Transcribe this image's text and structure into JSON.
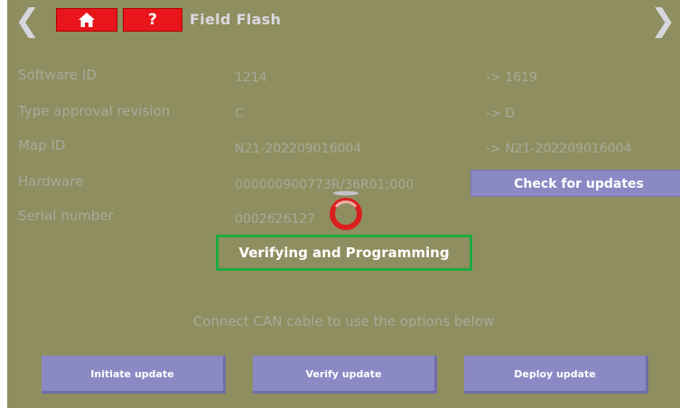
{
  "header": {
    "back_icon": "chevron-left-icon",
    "home_icon": "home-icon",
    "help_label": "?",
    "title": "Field Flash",
    "forward_icon": "chevron-right-icon",
    "accent_color": "#e8161b"
  },
  "info": {
    "rows": [
      {
        "label": "Software ID",
        "current": "1214",
        "target": "-> 1619"
      },
      {
        "label": "Type approval revision",
        "current": "C",
        "target": "-> D"
      },
      {
        "label": "Map ID",
        "current": "N21-202209016004",
        "target": "-> N21-202209016004"
      },
      {
        "label": "Hardware",
        "current": "000000900773R/36R01;000"
      },
      {
        "label": "Serial number",
        "current": "0002626127"
      }
    ],
    "check_button": "Check for updates"
  },
  "status": {
    "spinner_icon": "loading-spinner-icon",
    "message": "Verifying and Programming",
    "highlight_color": "#1cab3f"
  },
  "actions": {
    "instruction": "Connect CAN cable to use the options below",
    "initiate": "Initiate update",
    "verify": "Verify update",
    "deploy": "Deploy update"
  }
}
